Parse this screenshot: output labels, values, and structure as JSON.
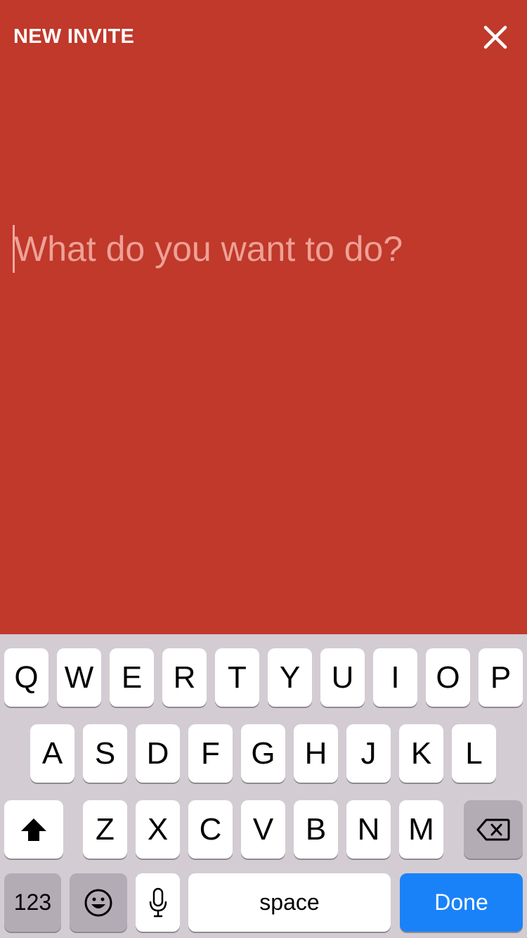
{
  "header": {
    "title": "NEW INVITE",
    "close_icon": "close-icon"
  },
  "prompt": {
    "placeholder": "What do you want to do?",
    "value": ""
  },
  "colors": {
    "background": "#C0392B",
    "keyboard_background": "#D3CCD3",
    "done_key": "#1A82F8"
  },
  "keyboard": {
    "row1": [
      "Q",
      "W",
      "E",
      "R",
      "T",
      "Y",
      "U",
      "I",
      "O",
      "P"
    ],
    "row2": [
      "A",
      "S",
      "D",
      "F",
      "G",
      "H",
      "J",
      "K",
      "L"
    ],
    "row3": [
      "Z",
      "X",
      "C",
      "V",
      "B",
      "N",
      "M"
    ],
    "shift_icon": "shift-icon",
    "backspace_icon": "backspace-icon",
    "numbers_label": "123",
    "emoji_icon": "emoji-icon",
    "mic_icon": "microphone-icon",
    "space_label": "space",
    "done_label": "Done"
  }
}
